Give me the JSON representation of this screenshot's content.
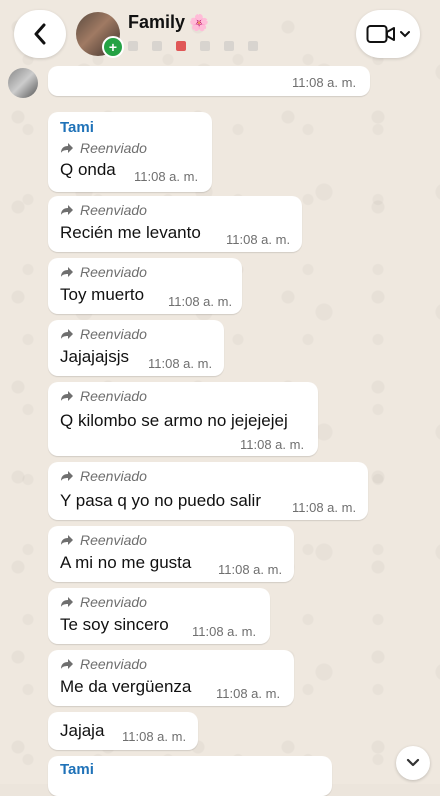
{
  "header": {
    "title": "Family",
    "title_emoji": "🌸",
    "back_icon": "chevron-left-icon",
    "video_icon": "video-camera-icon",
    "dropdown_icon": "chevron-down-icon"
  },
  "messages": [
    {
      "time": "11:08 a. m."
    },
    {
      "sender": "Tami",
      "forwarded_label": "Reenviado",
      "text": "Q onda",
      "time": "11:08 a. m."
    },
    {
      "forwarded_label": "Reenviado",
      "text": "Recién me levanto",
      "time": "11:08 a. m."
    },
    {
      "forwarded_label": "Reenviado",
      "text": "Toy muerto",
      "time": "11:08 a. m."
    },
    {
      "forwarded_label": "Reenviado",
      "text": "Jajajajsjs",
      "time": "11:08 a. m."
    },
    {
      "forwarded_label": "Reenviado",
      "text": "Q kilombo se armo no jejejejej",
      "time": "11:08 a. m."
    },
    {
      "forwarded_label": "Reenviado",
      "text": "Y pasa q yo no puedo salir",
      "time": "11:08 a. m."
    },
    {
      "forwarded_label": "Reenviado",
      "text": "A mi no me gusta",
      "time": "11:08 a. m."
    },
    {
      "forwarded_label": "Reenviado",
      "text": "Te soy sincero",
      "time": "11:08 a. m."
    },
    {
      "forwarded_label": "Reenviado",
      "text": "Me da vergüenza",
      "time": "11:08 a. m."
    },
    {
      "text": "Jajaja",
      "time": "11:08 a. m."
    },
    {
      "sender": "Tami"
    }
  ],
  "colors": {
    "sender": "#1f72b8",
    "online_badge": "#25a244"
  }
}
